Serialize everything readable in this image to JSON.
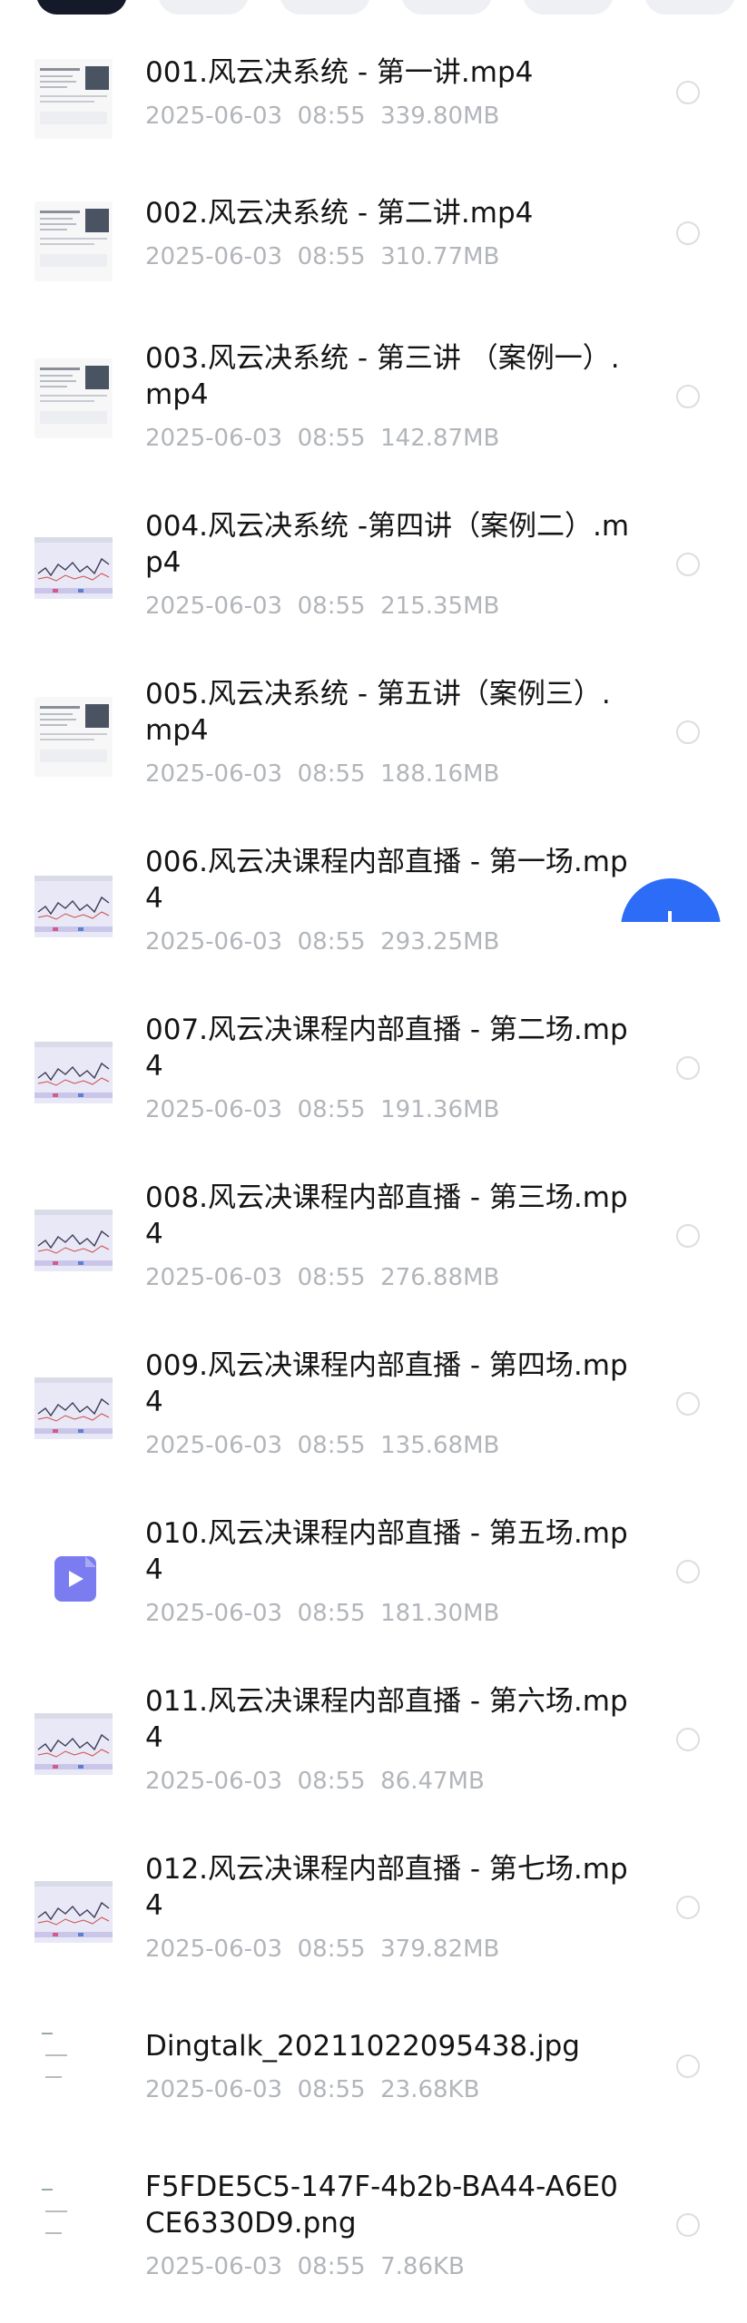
{
  "files": [
    {
      "name": "001.风云决系统 - 第一讲.mp4",
      "date": "2025-06-03",
      "time": "08:55",
      "size": "339.80MB",
      "thumb_icon": "doc-thumbnail-icon"
    },
    {
      "name": "002.风云决系统 - 第二讲.mp4",
      "date": "2025-06-03",
      "time": "08:55",
      "size": "310.77MB",
      "thumb_icon": "doc-thumbnail-icon"
    },
    {
      "name": "003.风云决系统 - 第三讲 （案例一）.mp4",
      "date": "2025-06-03",
      "time": "08:55",
      "size": "142.87MB",
      "thumb_icon": "doc-thumbnail-icon"
    },
    {
      "name": "004.风云决系统 -第四讲（案例二）.mp4",
      "date": "2025-06-03",
      "time": "08:55",
      "size": "215.35MB",
      "thumb_icon": "chart-thumbnail-icon"
    },
    {
      "name": "005.风云决系统 - 第五讲（案例三）.mp4",
      "date": "2025-06-03",
      "time": "08:55",
      "size": "188.16MB",
      "thumb_icon": "doc-thumbnail-icon"
    },
    {
      "name": "006.风云决课程内部直播 - 第一场.mp4",
      "date": "2025-06-03",
      "time": "08:55",
      "size": "293.25MB",
      "thumb_icon": "chart-thumbnail-icon"
    },
    {
      "name": "007.风云决课程内部直播 - 第二场.mp4",
      "date": "2025-06-03",
      "time": "08:55",
      "size": "191.36MB",
      "thumb_icon": "chart-thumbnail-icon"
    },
    {
      "name": "008.风云决课程内部直播 - 第三场.mp4",
      "date": "2025-06-03",
      "time": "08:55",
      "size": "276.88MB",
      "thumb_icon": "chart-thumbnail-icon"
    },
    {
      "name": "009.风云决课程内部直播 - 第四场.mp4",
      "date": "2025-06-03",
      "time": "08:55",
      "size": "135.68MB",
      "thumb_icon": "chart-thumbnail-icon"
    },
    {
      "name": "010.风云决课程内部直播 - 第五场.mp4",
      "date": "2025-06-03",
      "time": "08:55",
      "size": "181.30MB",
      "thumb_icon": "video-file-icon"
    },
    {
      "name": "011.风云决课程内部直播 - 第六场.mp4",
      "date": "2025-06-03",
      "time": "08:55",
      "size": "86.47MB",
      "thumb_icon": "chart-thumbnail-icon"
    },
    {
      "name": "012.风云决课程内部直播 - 第七场.mp4",
      "date": "2025-06-03",
      "time": "08:55",
      "size": "379.82MB",
      "thumb_icon": "chart-thumbnail-icon"
    },
    {
      "name": "Dingtalk_20211022095438.jpg",
      "date": "2025-06-03",
      "time": "08:55",
      "size": "23.68KB",
      "thumb_icon": "image-thumbnail-icon"
    },
    {
      "name": "F5FDE5C5-147F-4b2b-BA44-A6E0CE6330D9.png",
      "date": "2025-06-03",
      "time": "08:55",
      "size": "7.86KB",
      "thumb_icon": "image-thumbnail-icon"
    }
  ],
  "colors": {
    "accent": "#2c6cf6",
    "video_icon": "#7b7cf0",
    "meta_text": "#b2b5ba",
    "chip_active": "#151a2a"
  }
}
